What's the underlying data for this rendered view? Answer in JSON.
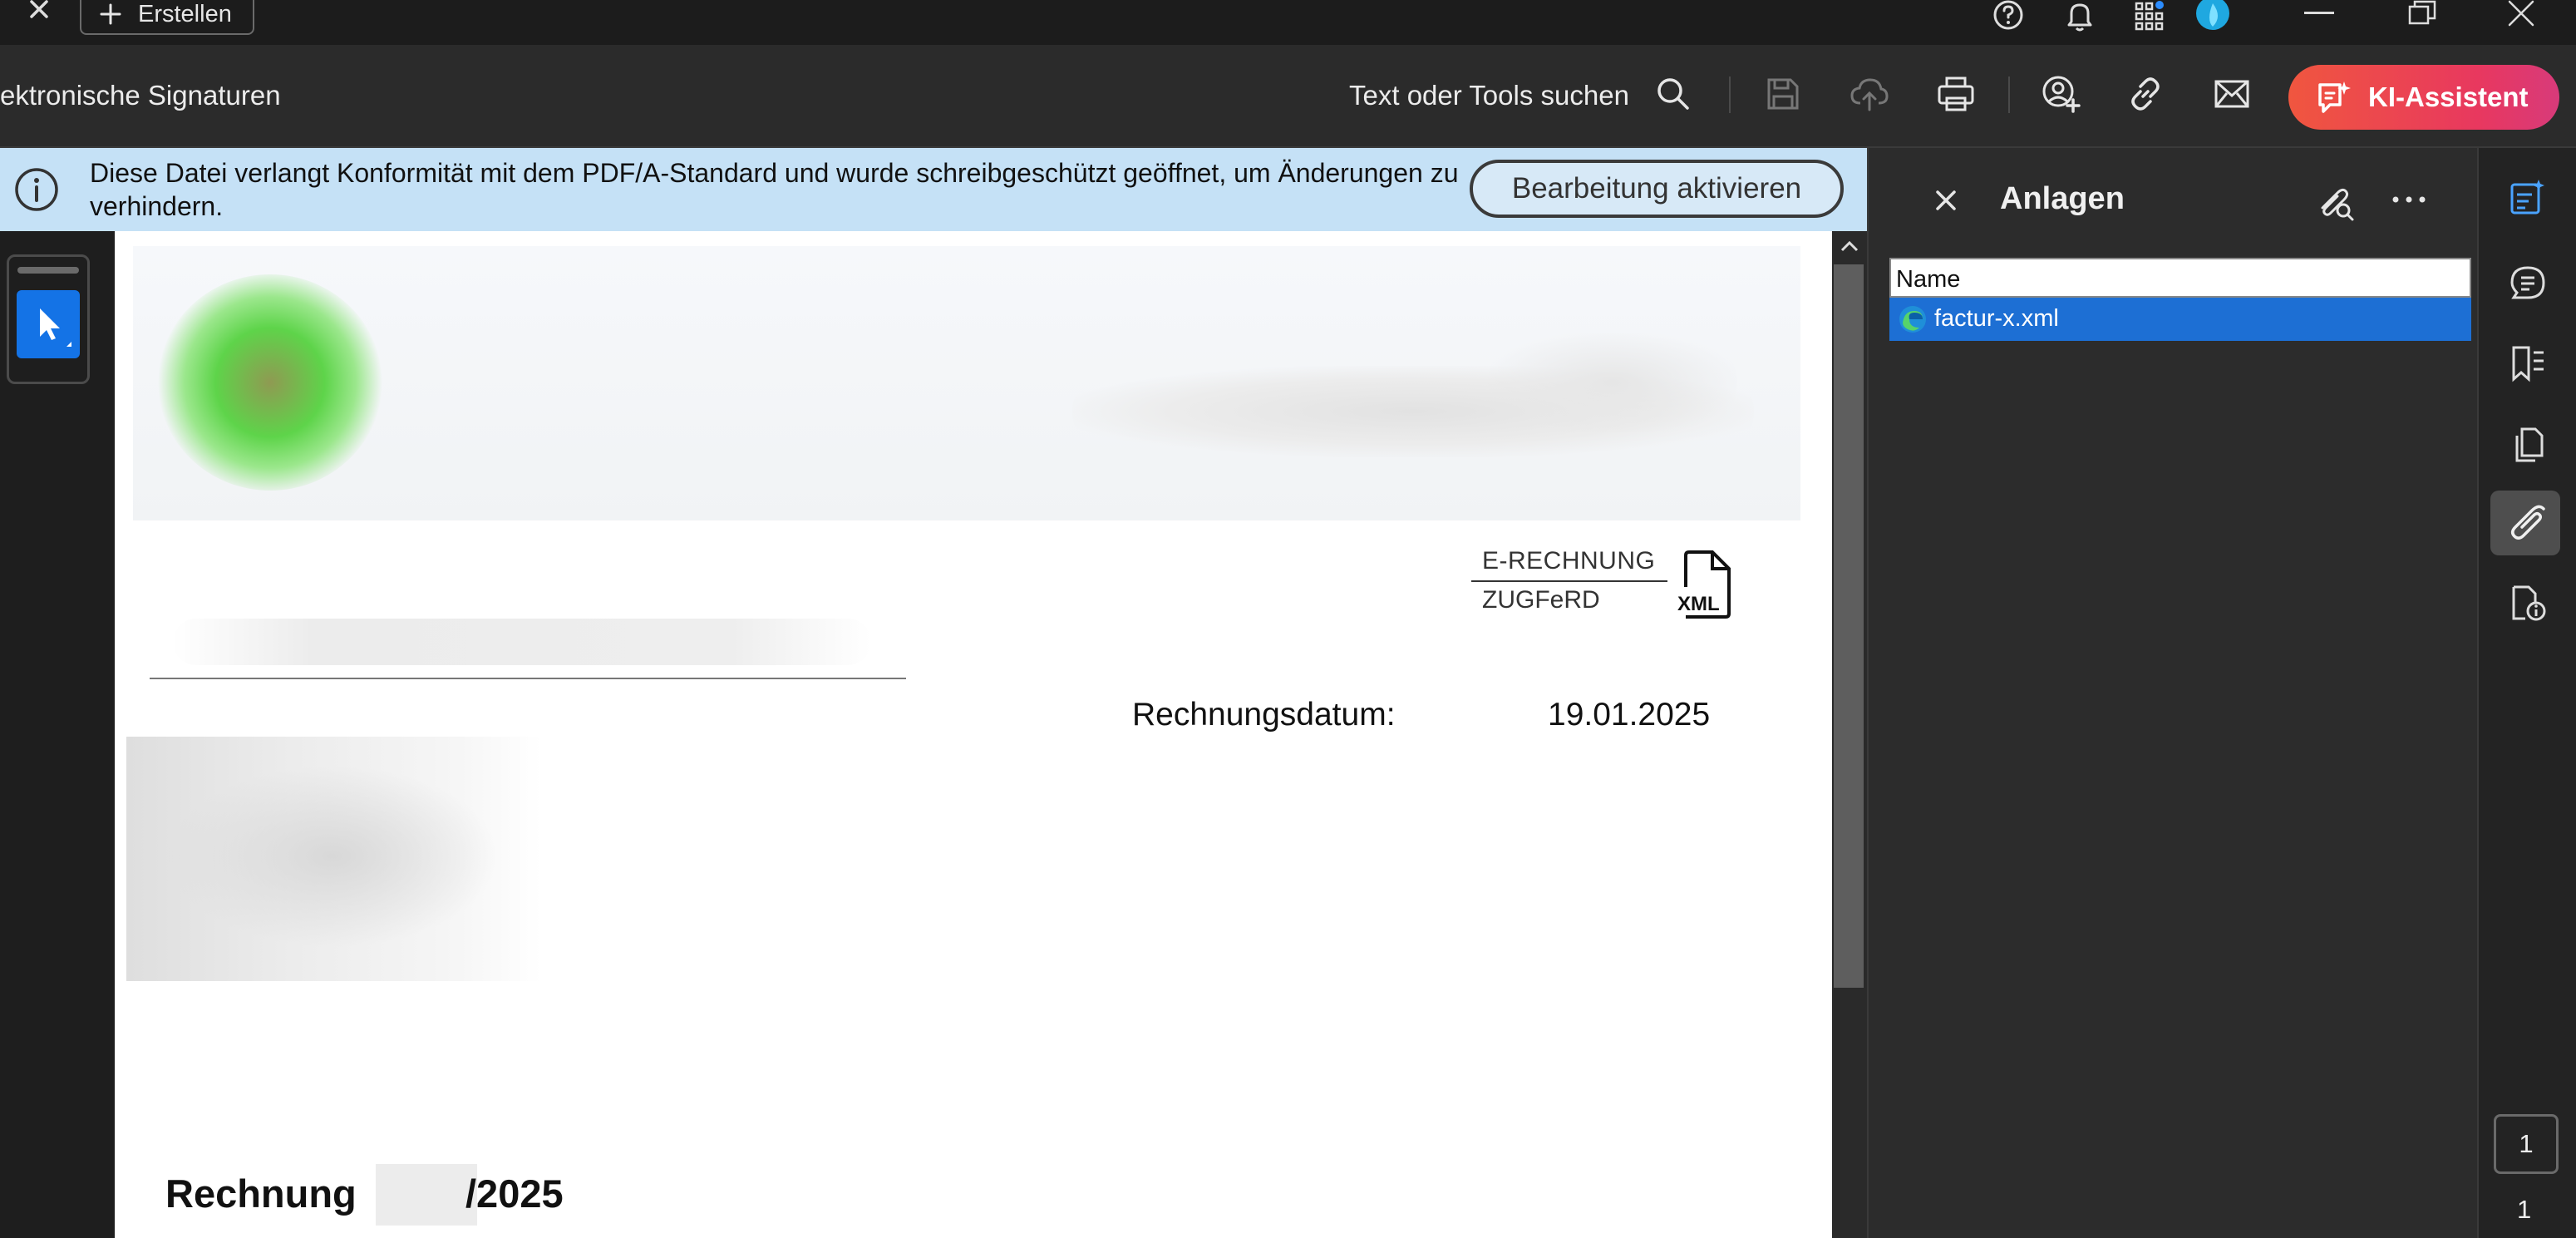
{
  "titlebar": {
    "create_label": "Erstellen",
    "icons": [
      "close-icon",
      "plus-icon",
      "help-icon",
      "bell-icon",
      "apps-icon",
      "profile-icon",
      "minimize-icon",
      "maximize-icon",
      "window-close-icon"
    ]
  },
  "toolbar": {
    "title": "ektronische Signaturen",
    "search_label": "Text oder Tools suchen",
    "ai_label": "KI-Assistent",
    "icons": [
      "search-icon",
      "save-icon",
      "cloud-upload-icon",
      "print-icon",
      "share-user-icon",
      "link-icon",
      "mail-icon",
      "ai-assistant-icon"
    ]
  },
  "banner": {
    "text": "Diese Datei verlangt Konformität mit dem PDF/A-Standard und wurde schreibgeschützt geöffnet, um Änderungen zu verhindern.",
    "button_label": "Bearbeitung aktivieren"
  },
  "document": {
    "zugferd_top": "E-RECHNUNG",
    "zugferd_bottom": "ZUGFeRD",
    "xml_label": "XML",
    "date_label": "Rechnungsdatum:",
    "date_value": "19.01.2025",
    "invoice_prefix": "Rechnung",
    "invoice_suffix": "/2025"
  },
  "panel": {
    "title": "Anlagen",
    "column_header": "Name",
    "attachments": [
      {
        "name": "factur-x.xml",
        "selected": true
      }
    ]
  },
  "pager": {
    "current": "1",
    "total": "1"
  },
  "colors": {
    "accent": "#1473e6",
    "selection": "#1d6fd4",
    "banner": "#c5e1f6",
    "ai_gradient_start": "#f0563f",
    "ai_gradient_end": "#d83a7a"
  }
}
